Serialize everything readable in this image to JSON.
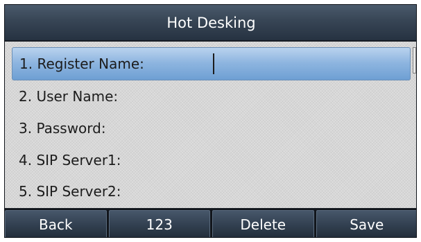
{
  "title": "Hot Desking",
  "fields": [
    {
      "label": "1. Register Name:",
      "value": "",
      "selected": true
    },
    {
      "label": "2. User Name:",
      "value": ""
    },
    {
      "label": "3. Password:",
      "value": ""
    },
    {
      "label": "4. SIP Server1:",
      "value": ""
    },
    {
      "label": "5. SIP Server2:",
      "value": ""
    }
  ],
  "softkeys": [
    {
      "label": "Back"
    },
    {
      "label": "123"
    },
    {
      "label": "Delete"
    },
    {
      "label": "Save"
    }
  ],
  "colors": {
    "selection": "#8fb6e0",
    "title_bar": "#374555",
    "content_background": "#d7d7d7"
  }
}
